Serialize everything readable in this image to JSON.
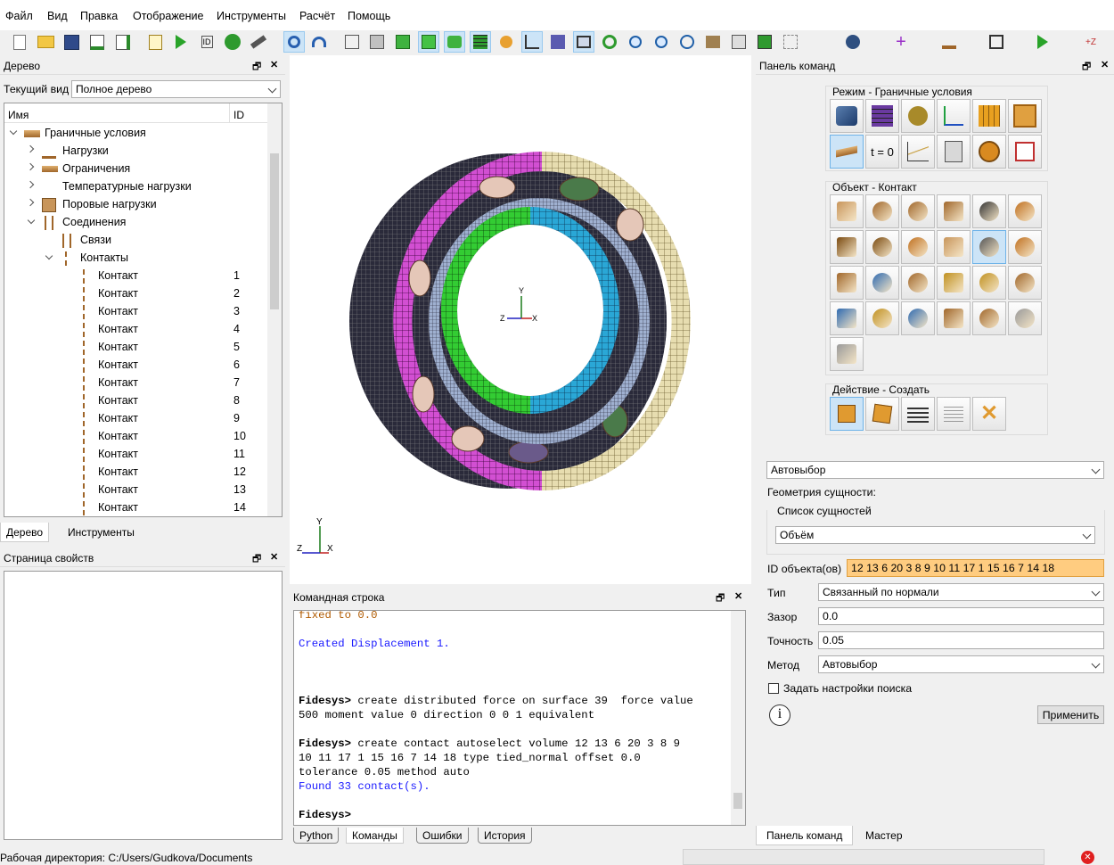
{
  "menu": [
    "Файл",
    "Вид",
    "Правка",
    "Отображение",
    "Инструменты",
    "Расчёт",
    "Помощь"
  ],
  "left_top_panel": {
    "title": "Дерево",
    "view_label": "Текущий вид",
    "view_value": "Полное дерево",
    "col_name": "Имя",
    "col_id": "ID",
    "tabs": [
      "Дерево",
      "Инструменты"
    ]
  },
  "tree": {
    "root": "Граничные условия",
    "loads": "Нагрузки",
    "constraints": "Ограничения",
    "temp_loads": "Температурные нагрузки",
    "pore_loads": "Поровые нагрузки",
    "joints": "Соединения",
    "ties": "Связи",
    "contacts": "Контакты",
    "contact_items": [
      {
        "name": "Контакт",
        "id": "1"
      },
      {
        "name": "Контакт",
        "id": "2"
      },
      {
        "name": "Контакт",
        "id": "3"
      },
      {
        "name": "Контакт",
        "id": "4"
      },
      {
        "name": "Контакт",
        "id": "5"
      },
      {
        "name": "Контакт",
        "id": "6"
      },
      {
        "name": "Контакт",
        "id": "7"
      },
      {
        "name": "Контакт",
        "id": "8"
      },
      {
        "name": "Контакт",
        "id": "9"
      },
      {
        "name": "Контакт",
        "id": "10"
      },
      {
        "name": "Контакт",
        "id": "11"
      },
      {
        "name": "Контакт",
        "id": "12"
      },
      {
        "name": "Контакт",
        "id": "13"
      },
      {
        "name": "Контакт",
        "id": "14"
      }
    ]
  },
  "props_panel": {
    "title": "Страница свойств"
  },
  "command_line": {
    "title": "Командная строка",
    "lines": [
      {
        "text": "fixed to 0.0",
        "cls": "brown"
      },
      {
        "text": "",
        "cls": ""
      },
      {
        "text": "Created Displacement 1.",
        "cls": "blue"
      },
      {
        "text": "",
        "cls": ""
      },
      {
        "text": "",
        "cls": ""
      },
      {
        "text": "",
        "cls": ""
      },
      {
        "prompt": "Fidesys>",
        "text": " create distributed force on surface 39  force value",
        "cls": ""
      },
      {
        "text": "500 moment value 0 direction 0 0 1 equivalent",
        "cls": ""
      },
      {
        "text": "",
        "cls": ""
      },
      {
        "prompt": "Fidesys>",
        "text": " create contact autoselect volume 12 13 6 20 3 8 9",
        "cls": ""
      },
      {
        "text": "10 11 17 1 15 16 7 14 18 type tied_normal offset 0.0",
        "cls": ""
      },
      {
        "text": "tolerance 0.05 method auto",
        "cls": ""
      },
      {
        "text": "Found 33 contact(s).",
        "cls": "blue"
      },
      {
        "text": "",
        "cls": ""
      },
      {
        "prompt": "Fidesys>",
        "text": "",
        "cls": ""
      }
    ],
    "tabs": [
      "Python",
      "Команды",
      "Ошибки",
      "История"
    ]
  },
  "cmd_panel": {
    "title": "Панель команд",
    "mode_group": "Режим - Граничные условия",
    "object_group": "Объект - Контакт",
    "action_group": "Действие - Создать",
    "t0_label": "t = 0",
    "autoselect": "Автовыбор",
    "entity_geometry": "Геометрия сущности:",
    "entity_list": "Список сущностей",
    "entity_type": "Объём",
    "object_ids_label": "ID объекта(ов)",
    "object_ids_value": "12 13 6 20 3 8 9 10 11 17 1 15 16 7 14 18",
    "type_label": "Тип",
    "type_value": "Связанный по нормали",
    "gap_label": "Зазор",
    "gap_value": "0.0",
    "tol_label": "Точность",
    "tol_value": "0.05",
    "method_label": "Метод",
    "method_value": "Автовыбор",
    "search_label": "Задать настройки поиска",
    "apply": "Применить",
    "tabs": [
      "Панель команд",
      "Мастер"
    ]
  },
  "status": {
    "workdir": "Рабочая директория: C:/Users/Gudkova/Documents"
  },
  "colors": {
    "highlight": "#ffcc80",
    "selected": "#cce4f7",
    "blue_text": "#1818ff"
  }
}
